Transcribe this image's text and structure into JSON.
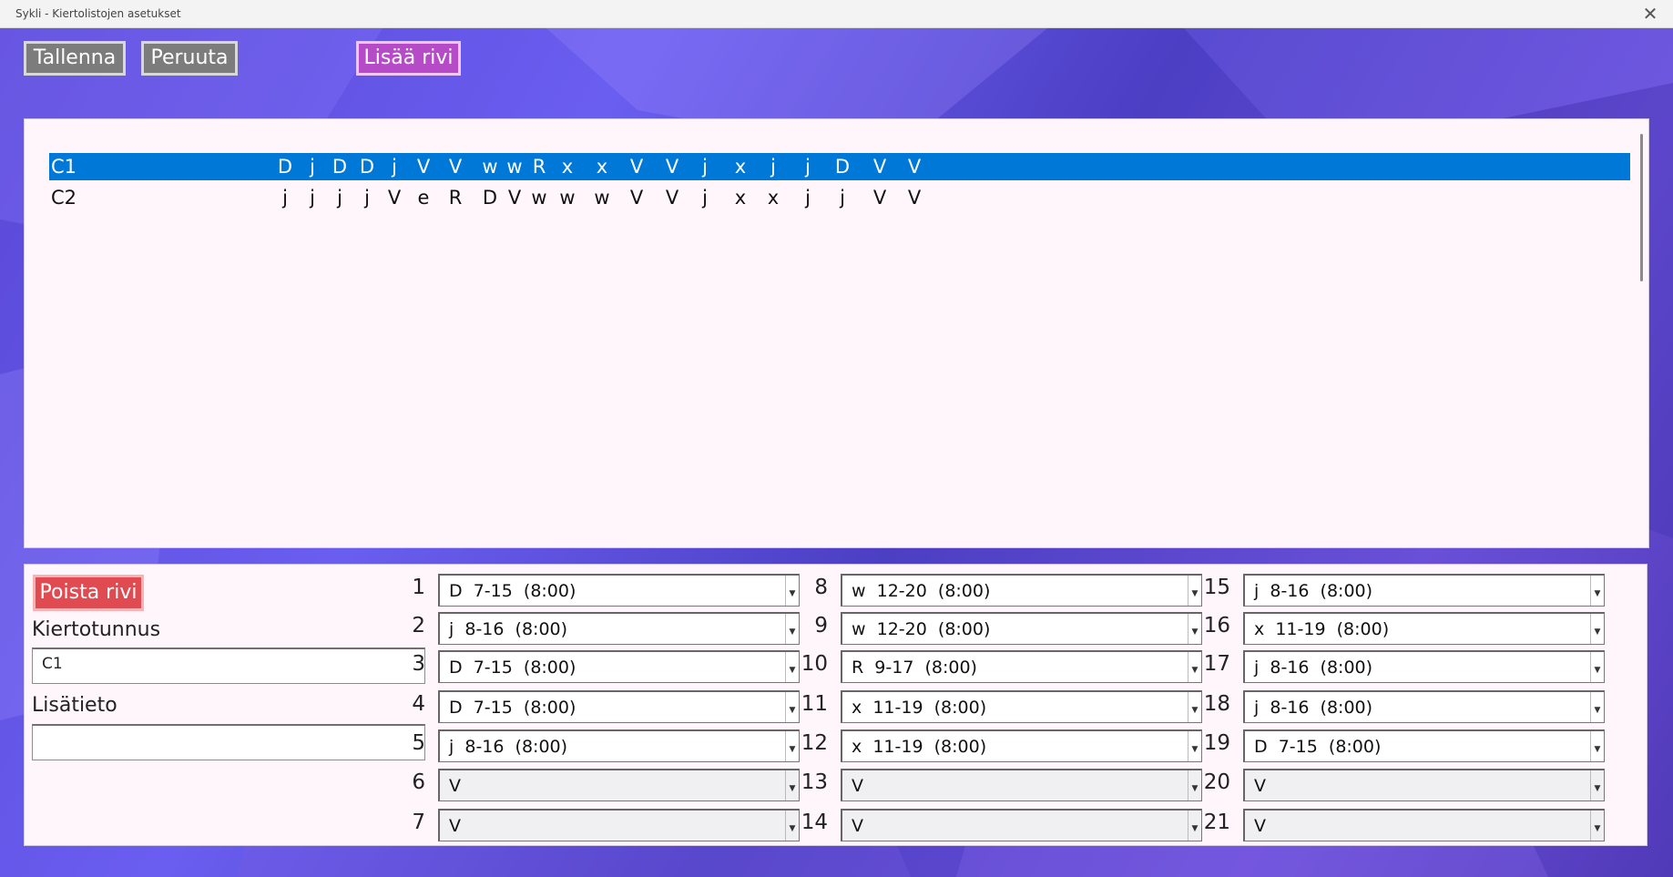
{
  "window": {
    "title": "Sykli - Kiertolistojen asetukset",
    "close_glyph": "✕"
  },
  "toolbar": {
    "save_label": "Tallenna",
    "cancel_label": "Peruuta",
    "add_row_label": "Lisää rivi"
  },
  "rotations": [
    {
      "code": "C1",
      "selected": true,
      "days": [
        "D",
        "j",
        "D",
        "D",
        "j",
        "V",
        "V",
        "w",
        "w",
        "R",
        "x",
        "x",
        "V",
        "V",
        "j",
        "x",
        "j",
        "j",
        "D",
        "V",
        "V"
      ]
    },
    {
      "code": "C2",
      "selected": false,
      "days": [
        "j",
        "j",
        "j",
        "j",
        "V",
        "e",
        "R",
        "D",
        "V",
        "w",
        "w",
        "w",
        "V",
        "V",
        "j",
        "x",
        "x",
        "j",
        "j",
        "V",
        "V"
      ]
    }
  ],
  "editor": {
    "delete_label": "Poista rivi",
    "id_label": "Kiertotunnus",
    "id_value": "C1",
    "info_label": "Lisätieto",
    "info_value": "",
    "days": [
      {
        "num": "1",
        "value": "D  7-15  (8:00)"
      },
      {
        "num": "2",
        "value": "j  8-16  (8:00)"
      },
      {
        "num": "3",
        "value": "D  7-15  (8:00)"
      },
      {
        "num": "4",
        "value": "D  7-15  (8:00)"
      },
      {
        "num": "5",
        "value": "j  8-16  (8:00)"
      },
      {
        "num": "6",
        "value": "V"
      },
      {
        "num": "7",
        "value": "V"
      },
      {
        "num": "8",
        "value": "w  12-20  (8:00)"
      },
      {
        "num": "9",
        "value": "w  12-20  (8:00)"
      },
      {
        "num": "10",
        "value": "R  9-17  (8:00)"
      },
      {
        "num": "11",
        "value": "x  11-19  (8:00)"
      },
      {
        "num": "12",
        "value": "x  11-19  (8:00)"
      },
      {
        "num": "13",
        "value": "V"
      },
      {
        "num": "14",
        "value": "V"
      },
      {
        "num": "15",
        "value": "j  8-16  (8:00)"
      },
      {
        "num": "16",
        "value": "x  11-19  (8:00)"
      },
      {
        "num": "17",
        "value": "j  8-16  (8:00)"
      },
      {
        "num": "18",
        "value": "j  8-16  (8:00)"
      },
      {
        "num": "19",
        "value": "D  7-15  (8:00)"
      },
      {
        "num": "20",
        "value": "V"
      },
      {
        "num": "21",
        "value": "V"
      }
    ]
  },
  "colors": {
    "selection": "#0078d7",
    "panel": "#fff6fb",
    "accent_button": "#b54bc7",
    "danger_button": "#e04b52",
    "neutral_button": "#7c7c7c"
  }
}
